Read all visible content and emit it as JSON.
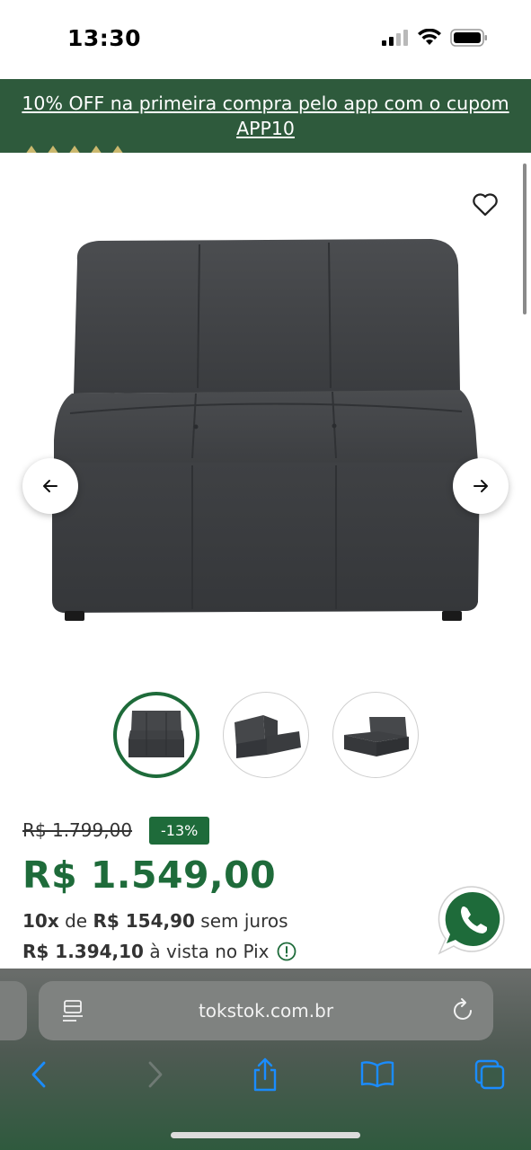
{
  "status_bar": {
    "time": "13:30",
    "icons": [
      "signal-icon",
      "wifi-icon",
      "battery-icon"
    ]
  },
  "promo": {
    "text": "10% OFF na primeira compra pelo app com o cupom APP10"
  },
  "product": {
    "image": "gray-tufted-armless-sofa-module",
    "favorite_icon": "heart-outline-icon",
    "prev_icon": "arrow-left-icon",
    "next_icon": "arrow-right-icon",
    "thumbnails": [
      {
        "name": "front-view",
        "active": true
      },
      {
        "name": "back-three-quarter-view",
        "active": false
      },
      {
        "name": "side-three-quarter-view",
        "active": false
      }
    ]
  },
  "pricing": {
    "old_price": "R$ 1.799,00",
    "discount": "-13%",
    "price": "R$ 1.549,00",
    "installments_count": "10x",
    "installments_de": "de",
    "installments_value": "R$ 154,90",
    "installments_suffix": "sem juros",
    "pix_price": "R$ 1.394,10",
    "pix_suffix": "à vista no Pix",
    "info_icon": "info-circle-icon"
  },
  "whatsapp": {
    "icon": "whatsapp-icon"
  },
  "browser": {
    "url": "tokstok.com.br",
    "icons": [
      "reader-icon",
      "reload-icon",
      "back-icon",
      "forward-icon",
      "share-icon",
      "bookmarks-icon",
      "tabs-icon"
    ]
  },
  "colors": {
    "brand_green": "#1e6b3a",
    "banner_green": "#2e5a3c",
    "browser_blue": "#1a8cff"
  }
}
